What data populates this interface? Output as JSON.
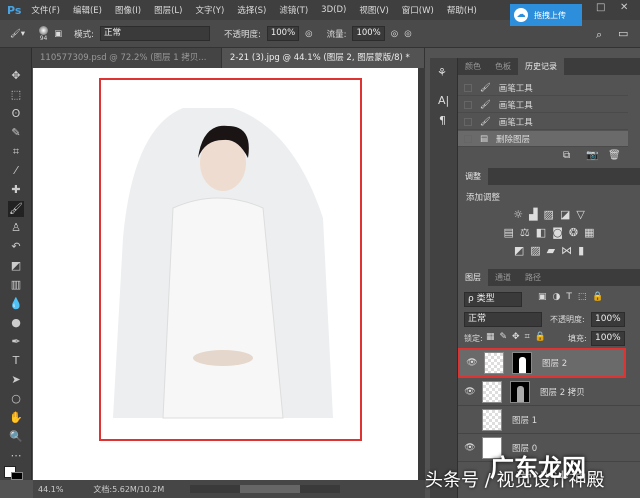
{
  "app": {
    "logo": "Ps",
    "upload_label": "拖拽上传"
  },
  "menu": [
    "文件(F)",
    "编辑(E)",
    "图像(I)",
    "图层(L)",
    "文字(Y)",
    "选择(S)",
    "滤镜(T)",
    "3D(D)",
    "视图(V)",
    "窗口(W)",
    "帮助(H)"
  ],
  "options": {
    "brush_size": "94",
    "mode_label": "模式:",
    "mode_value": "正常",
    "opacity_label": "不透明度:",
    "opacity_value": "100%",
    "flow_label": "流量:",
    "flow_value": "100%"
  },
  "tabs": [
    {
      "label": "110577309.psd @ 72.2% (图层 1 拷贝... ×"
    },
    {
      "label": "2-21 (3).jpg @ 44.1% (图层 2, 图层蒙版/8) * ×"
    }
  ],
  "history": {
    "tabs": [
      "颜色",
      "色板",
      "历史记录"
    ],
    "items": [
      "画笔工具",
      "画笔工具",
      "画笔工具",
      "删除图层"
    ]
  },
  "adjustments": {
    "tab": "调整",
    "title": "添加调整"
  },
  "layers": {
    "tabs": [
      "图层",
      "通道",
      "路径"
    ],
    "filter": "ρ 类型",
    "blend": "正常",
    "opacity_label": "不透明度:",
    "opacity": "100%",
    "lock_label": "锁定:",
    "fill_label": "填充:",
    "fill": "100%",
    "items": [
      {
        "name": "图层 2",
        "visible": true,
        "mask": true,
        "selected": true
      },
      {
        "name": "图层 2 拷贝",
        "visible": true,
        "mask": true
      },
      {
        "name": "图层 1",
        "visible": false
      },
      {
        "name": "图层 0",
        "visible": true
      }
    ]
  },
  "status": {
    "zoom": "44.1%",
    "doc": "文档:5.62M/10.2M"
  },
  "watermark": "头条号 / 视觉设计神殿",
  "watermark2": "广东龙网"
}
